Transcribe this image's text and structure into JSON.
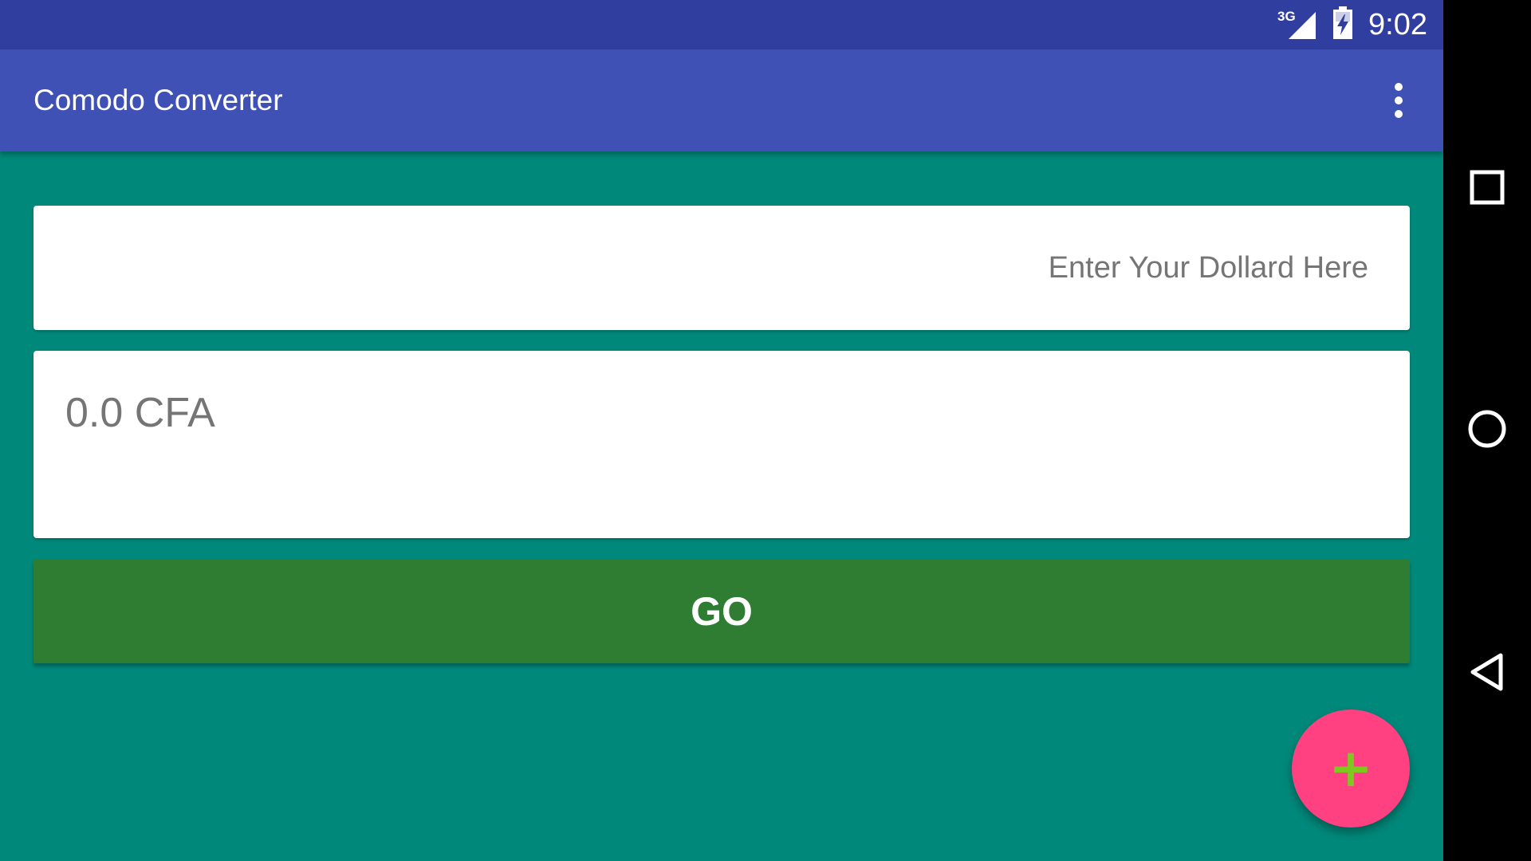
{
  "status_bar": {
    "network_label": "3G",
    "time": "9:02",
    "icons": [
      "signal-icon",
      "battery-charging-icon"
    ]
  },
  "app_bar": {
    "title": "Comodo Converter",
    "menu_icon": "overflow-menu-icon"
  },
  "converter": {
    "dollar_input": {
      "placeholder": "Enter Your Dollard Here",
      "value": ""
    },
    "result_text": "0.0 CFA",
    "go_label": "GO"
  },
  "fab": {
    "icon": "plus-icon",
    "glyph": "+"
  },
  "navigation_bar": {
    "buttons": [
      "recents-icon",
      "home-icon",
      "back-icon"
    ]
  },
  "colors": {
    "status_bar": "#303f9f",
    "app_bar": "#3f51b5",
    "background": "#00897b",
    "go_button": "#2e7d32",
    "fab": "#ff4081",
    "fab_plus": "#7ec820"
  }
}
